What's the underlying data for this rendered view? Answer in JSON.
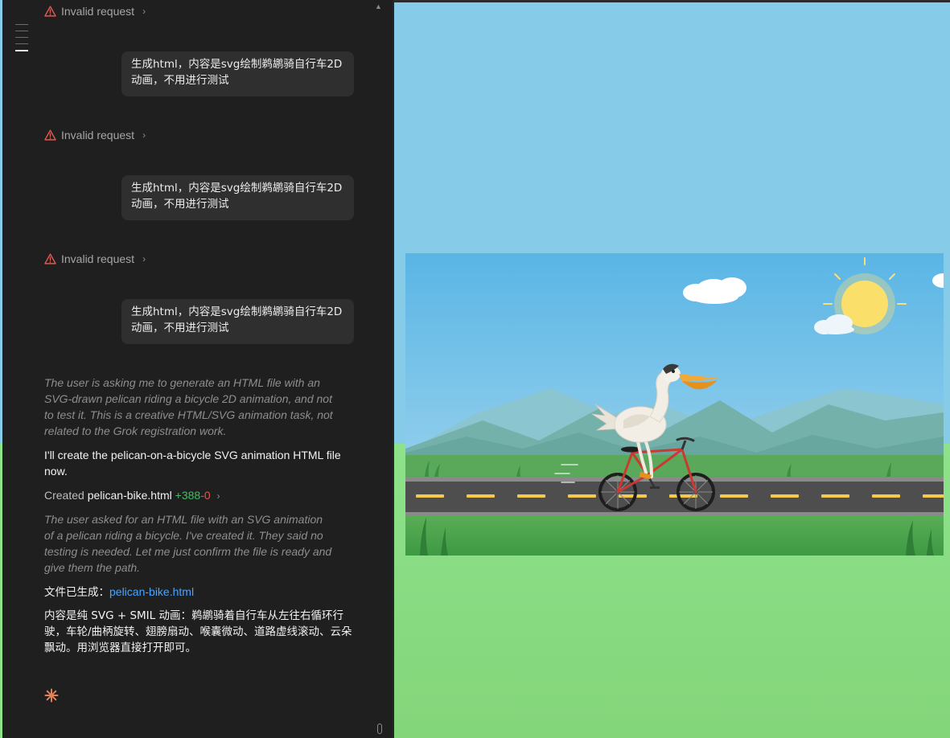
{
  "chat": {
    "messages": [
      {
        "type": "error",
        "label": "Invalid request"
      },
      {
        "type": "user",
        "text": "生成html，内容是svg绘制鹈鹕骑自行车2D动画，不用进行测试"
      },
      {
        "type": "error",
        "label": "Invalid request"
      },
      {
        "type": "user",
        "text": "生成html，内容是svg绘制鹈鹕骑自行车2D动画，不用进行测试"
      },
      {
        "type": "error",
        "label": "Invalid request"
      },
      {
        "type": "user",
        "text": "生成html，内容是svg绘制鹈鹕骑自行车2D动画，不用进行测试"
      }
    ],
    "thinking_1": "The user is asking me to generate an HTML file with an SVG-drawn pelican riding a bicycle 2D animation, and not to test it. This is a creative HTML/SVG animation task, not related to the Grok registration work.",
    "reply_1": "I'll create the pelican-on-a-bicycle SVG animation HTML file now.",
    "created": {
      "prefix": "Created",
      "filename": "pelican-bike.html",
      "added": "+388",
      "removed": "-0"
    },
    "thinking_2": "The user asked for an HTML file with an SVG animation of a pelican riding a bicycle. I've created it. They said no testing is needed. Let me just confirm the file is ready and give them the path.",
    "file_ready_prefix": "文件已生成：",
    "file_link": "pelican-bike.html",
    "summary": "内容是纯 SVG + SMIL 动画：鹈鹕骑着自行车从左往右循环行驶，车轮/曲柄旋转、翅膀扇动、喉囊微动、道路虚线滚动、云朵飘动。用浏览器直接打开即可。"
  },
  "icons": {
    "warning": "warning-triangle-icon",
    "spark": "spark-icon"
  },
  "colors": {
    "error": "#e0584f",
    "link": "#4aa3ff",
    "diff_add": "#3fbf5f",
    "diff_remove": "#e0584f",
    "preview_sky": "#86cbe7",
    "preview_grass": "#8de28a"
  }
}
